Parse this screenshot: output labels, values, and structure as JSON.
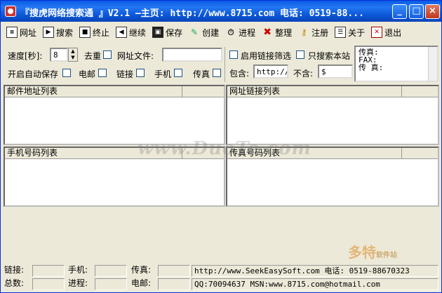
{
  "window": {
    "title": "『搜虎网络搜索通 』V2.1  —主页: http://www.8715.com 电话: 0519-88..."
  },
  "toolbar": [
    {
      "label": "网址",
      "icon": "url-icon"
    },
    {
      "label": "搜索",
      "icon": "play-icon"
    },
    {
      "label": "终止",
      "icon": "stop-icon"
    },
    {
      "label": "继续",
      "icon": "resume-icon"
    },
    {
      "label": "保存",
      "icon": "floppy-icon"
    },
    {
      "label": "创建",
      "icon": "create-icon"
    },
    {
      "label": "进程",
      "icon": "progress-icon"
    },
    {
      "label": "整理",
      "icon": "tidy-icon"
    },
    {
      "label": "注册",
      "icon": "key-icon"
    },
    {
      "label": "关于",
      "icon": "about-icon"
    },
    {
      "label": "退出",
      "icon": "exit-icon"
    }
  ],
  "settings": {
    "speed_label": "速度[秒]:",
    "speed_value": "8",
    "dedupe_label": "去重",
    "url_file_label": "网址文件:",
    "url_file_value": "",
    "autosave_label": "开启自动保存",
    "email_label": "电邮",
    "link_label": "链接",
    "mobile_label": "手机",
    "fax_label": "传真",
    "enable_filter_label": "启用链接筛选",
    "only_site_label": "只搜索本站",
    "include_label": "包含:",
    "include_value": "http://",
    "exclude_label": "不含:",
    "exclude_value": "$"
  },
  "info_box": [
    "传真:",
    "FAX:",
    "传 真:"
  ],
  "panes": {
    "email": "邮件地址列表",
    "url": "网址链接列表",
    "mobile": "手机号码列表",
    "fax": "传真号码列表"
  },
  "watermark": "www.DuoTe.com",
  "status": {
    "links_label": "链接:",
    "mobile_label": "手机:",
    "fax_label": "传真:",
    "total_label": "总数:",
    "progress_label": "进程:",
    "email_label": "电邮:",
    "line1": "http://www.SeekEasySoft.com 电话: 0519-88670323",
    "line2": "QQ:70094637 MSN:www.8715.com@hotmail.com"
  },
  "logo_watermark": {
    "main": "多特",
    "sub": "软件站"
  }
}
